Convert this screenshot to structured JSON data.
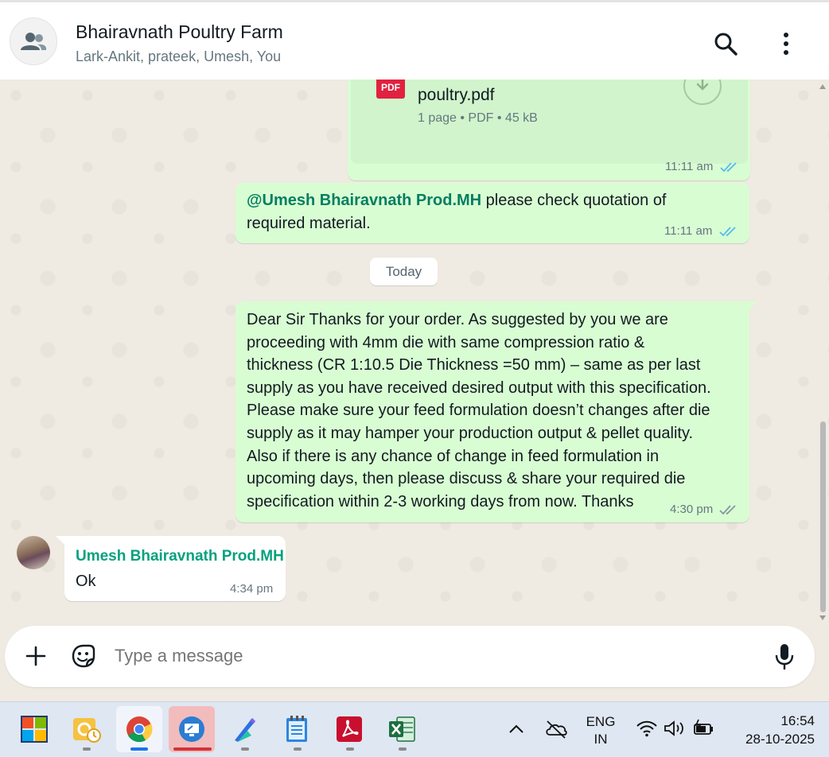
{
  "header": {
    "title": "Bhairavnath Poultry Farm",
    "members": "Lark-Ankit, prateek, Umesh, You"
  },
  "messages": {
    "doc": {
      "filename": "poultry.pdf",
      "pdf_label": "PDF",
      "meta": "1 page • PDF • 45 kB",
      "time": "11:11 am"
    },
    "mention_msg": {
      "mention": "@Umesh Bhairavnath Prod.MH",
      "text_line1": " please check quotation of",
      "text_line2": "required material.",
      "time": "11:11 am"
    },
    "date_separator": "Today",
    "long_msg": {
      "lines": [
        "Dear Sir Thanks for your order. As suggested by you we are",
        "proceeding with  4mm die with same compression ratio &",
        "thickness (CR 1:10.5 Die Thickness =50 mm) – same as per last",
        "supply as you have received desired output with this specification.",
        "Please make sure your feed formulation doesn’t changes after die",
        "supply as it may hamper your production output & pellet quality.",
        "Also if there is any chance of change in feed formulation in",
        "upcoming days, then please discuss & share your required die",
        "specification within 2-3 working days from now. Thanks"
      ],
      "time": "4:30 pm"
    },
    "reply": {
      "sender": "Umesh Bhairavnath Prod.MH",
      "text": "Ok",
      "time": "4:34 pm"
    }
  },
  "composer": {
    "placeholder": "Type a message"
  },
  "taskbar": {
    "lang_line1": "ENG",
    "lang_line2": "IN",
    "time": "16:54",
    "date": "28-10-2025"
  },
  "colors": {
    "outgoing_bubble": "#d9fdd3",
    "read_tick": "#53bdeb",
    "mention": "#027e62",
    "sender_name": "#06a17e"
  }
}
